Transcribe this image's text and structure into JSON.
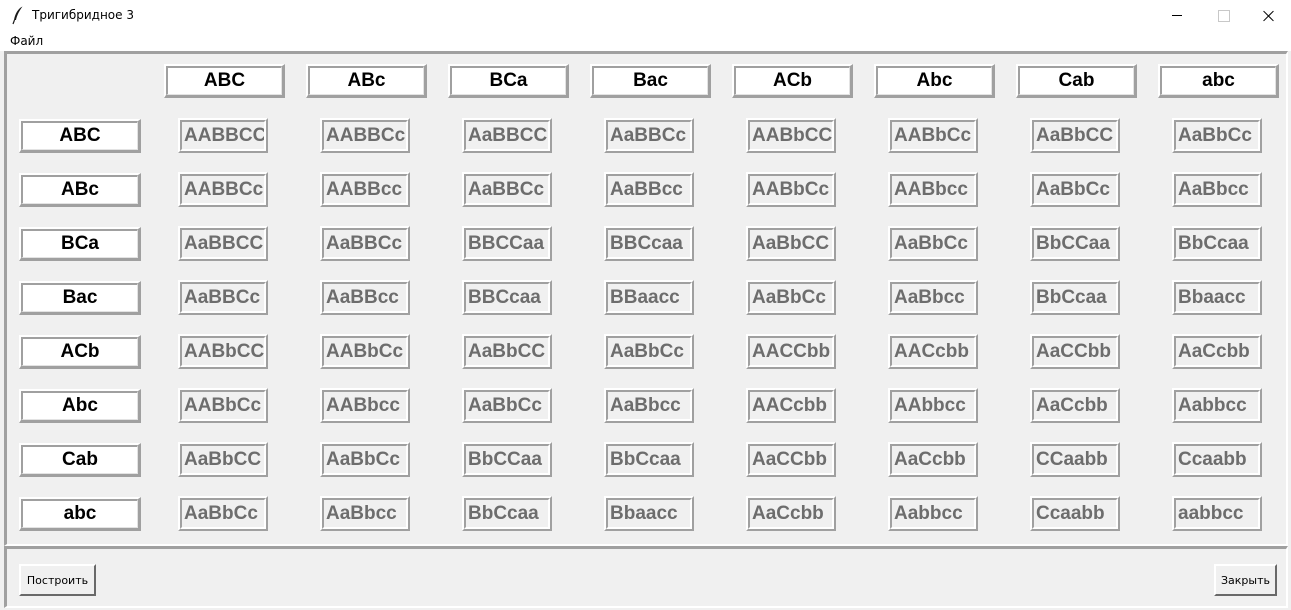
{
  "window": {
    "title": "Тригибридное 3",
    "icon": "feather-icon",
    "controls": [
      "minimize-icon",
      "maximize-icon",
      "close-icon"
    ]
  },
  "menu": {
    "file": "Файл"
  },
  "grid": {
    "column_gametes": [
      "ABC",
      "ABc",
      "BCa",
      "Bac",
      "ACb",
      "Abc",
      "Cab",
      "abc"
    ],
    "row_gametes": [
      "ABC",
      "ABc",
      "BCa",
      "Bac",
      "ACb",
      "Abc",
      "Cab",
      "abc"
    ],
    "cells": [
      [
        "AABBCC",
        "AABBCc",
        "AaBBCC",
        "AaBBCc",
        "AABbCC",
        "AABbCc",
        "AaBbCC",
        "AaBbCc"
      ],
      [
        "AABBCc",
        "AABBcc",
        "AaBBCc",
        "AaBBcc",
        "AABbCc",
        "AABbcc",
        "AaBbCc",
        "AaBbcc"
      ],
      [
        "AaBBCC",
        "AaBBCc",
        "BBCCaa",
        "BBCcaa",
        "AaBbCC",
        "AaBbCc",
        "BbCCaa",
        "BbCcaa"
      ],
      [
        "AaBBCc",
        "AaBBcc",
        "BBCcaa",
        "BBaacc",
        "AaBbCc",
        "AaBbcc",
        "BbCcaa",
        "Bbaacc"
      ],
      [
        "AABbCC",
        "AABbCc",
        "AaBbCC",
        "AaBbCc",
        "AACCbb",
        "AACcbb",
        "AaCCbb",
        "AaCcbb"
      ],
      [
        "AABbCc",
        "AABbcc",
        "AaBbCc",
        "AaBbcc",
        "AACcbb",
        "AAbbcc",
        "AaCcbb",
        "Aabbcc"
      ],
      [
        "AaBbCC",
        "AaBbCc",
        "BbCCaa",
        "BbCcaa",
        "AaCCbb",
        "AaCcbb",
        "CCaabb",
        "Ccaabb"
      ],
      [
        "AaBbCc",
        "AaBbcc",
        "BbCcaa",
        "Bbaacc",
        "AaCcbb",
        "Aabbcc",
        "Ccaabb",
        "aabbcc"
      ]
    ]
  },
  "actions": {
    "build": "Построить",
    "close": "Закрыть"
  }
}
